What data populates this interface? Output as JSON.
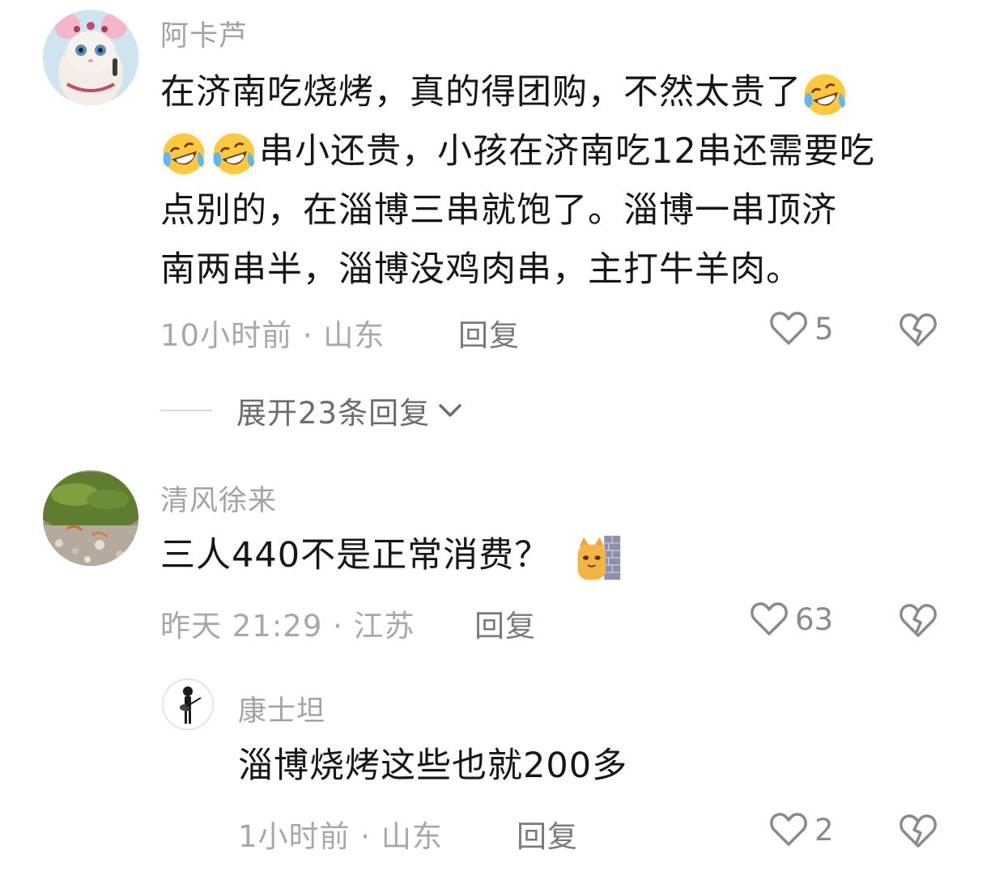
{
  "comments": [
    {
      "username": "阿卡芦",
      "text_line1": "在济南吃烧烤，真的得团购，不然太贵了",
      "text_line2": "串小还贵，小孩在济南吃12串还需要吃",
      "text_line3": "点别的，在淄博三串就饱了。淄博一串顶济",
      "text_line4": "南两串半，淄博没鸡肉串，主打牛羊肉。",
      "time": "10小时前 · 山东",
      "reply_label": "回复",
      "likes": "5",
      "expand_label": "展开23条回复",
      "emoji": "laughing-crying-emoji"
    },
    {
      "username": "清风徐来",
      "text": "三人440不是正常消费？",
      "time": "昨天 21:29 · 江苏",
      "reply_label": "回复",
      "likes": "63",
      "emoji": "cat-peeking-emoji"
    },
    {
      "username": "康士坦",
      "text": "淄博烧烤这些也就200多",
      "time": "1小时前 · 山东",
      "reply_label": "回复",
      "likes": "2"
    }
  ],
  "icons": {
    "like": "heart-outline-icon",
    "dislike": "broken-heart-icon",
    "expand": "chevron-down-icon"
  },
  "colors": {
    "username": "#a3a3a3",
    "text": "#161616",
    "meta": "#a8a8a8",
    "emoji_yellow": "#ffc83d"
  }
}
